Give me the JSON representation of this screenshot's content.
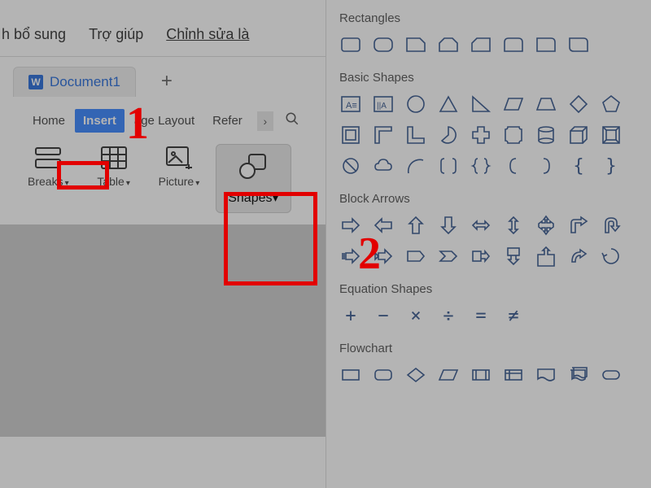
{
  "top_menu": {
    "item1": "h bổ sung",
    "item2": "Trợ giúp",
    "item3": "Chỉnh sửa là"
  },
  "document_tab": {
    "icon_text": "W",
    "title": "Document1"
  },
  "plus_label": "+",
  "ribbon_tabs": {
    "home": "Home",
    "insert": "Insert",
    "page_layout": "age Layout",
    "references": "Refer",
    "more": "›"
  },
  "search_icon_glyph": "🔍",
  "ribbon_groups": {
    "breaks": "Breaks",
    "table": "Table",
    "picture": "Picture",
    "shapes": "Shapes"
  },
  "caret": "▾",
  "annotations": {
    "num1": "1",
    "num2": "2"
  },
  "shapes_panel": {
    "rectangles": {
      "title": "Rectangles",
      "count": 8
    },
    "basic_shapes": {
      "title": "Basic Shapes",
      "rows": 3
    },
    "block_arrows": {
      "title": "Block Arrows"
    },
    "equation_shapes": {
      "title": "Equation Shapes",
      "glyphs": [
        "+",
        "−",
        "×",
        "÷",
        "=",
        "≠"
      ]
    },
    "flowchart": {
      "title": "Flowchart"
    }
  }
}
